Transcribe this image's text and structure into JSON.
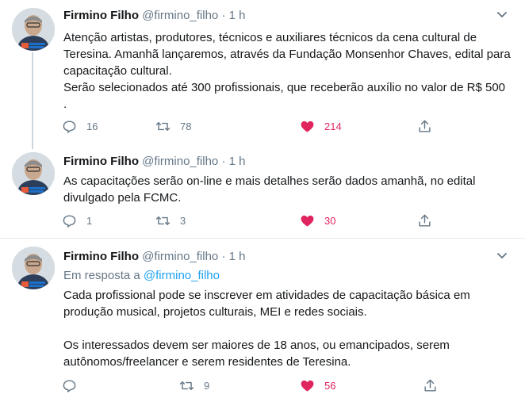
{
  "tweets": [
    {
      "name": "Firmino Filho",
      "handle": "@firmino_filho",
      "separator": "·",
      "time": "1 h",
      "reply_prefix": "",
      "reply_to": "",
      "text": "Atenção artistas, produtores, técnicos e auxiliares técnicos da cena cultural de Teresina. Amanhã lançaremos, através da Fundação Monsenhor Chaves, edital para capacitação cultural.\nSerão selecionados até 300 profissionais, que receberão auxílio no valor de R$ 500 .",
      "replies": "16",
      "retweets": "78",
      "likes": "214"
    },
    {
      "name": "Firmino Filho",
      "handle": "@firmino_filho",
      "separator": "·",
      "time": "1 h",
      "reply_prefix": "",
      "reply_to": "",
      "text": "As capacitações serão on-line e mais  detalhes serão dados amanhã, no edital divulgado pela FCMC.",
      "replies": "1",
      "retweets": "3",
      "likes": "30"
    },
    {
      "name": "Firmino Filho",
      "handle": "@firmino_filho",
      "separator": "·",
      "time": "1 h",
      "reply_prefix": "Em resposta a",
      "reply_to": "@firmino_filho",
      "text": "Cada profissional pode se inscrever em atividades de capacitação básica em produção musical, projetos culturais, MEI e redes sociais.\n\nOs interessados devem ser maiores de 18 anos, ou emancipados, serem autônomos/freelancer e serem residentes de Teresina.",
      "replies": "",
      "retweets": "9",
      "likes": "56"
    }
  ],
  "colors": {
    "like_active": "#e0245e",
    "mention": "#1da1f2",
    "muted": "#657786",
    "thread_line": "#ccd6dd",
    "divider": "#e6ecf0"
  },
  "icons": [
    "reply-icon",
    "retweet-icon",
    "like-icon",
    "share-icon",
    "chevron-down-icon"
  ]
}
